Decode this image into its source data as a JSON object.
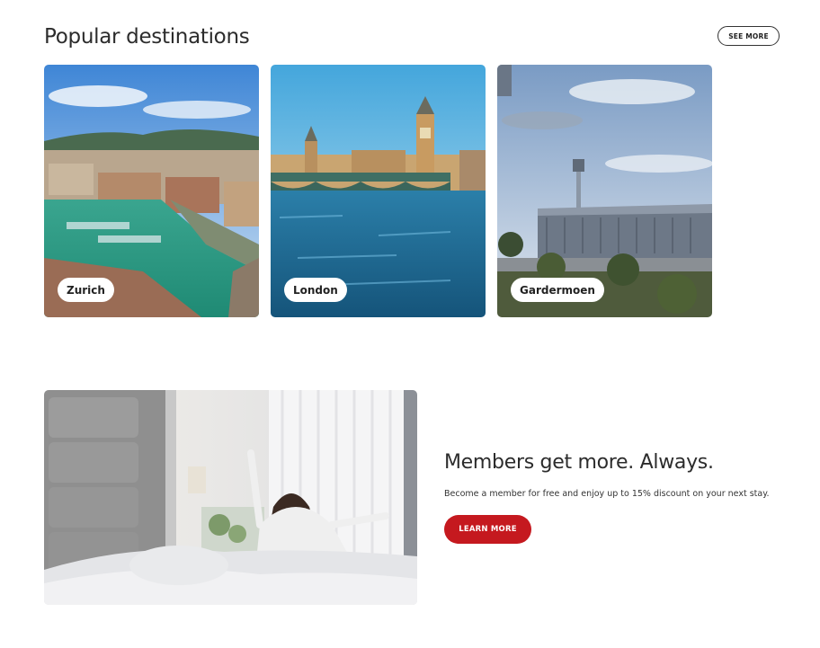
{
  "destinations": {
    "title": "Popular destinations",
    "see_more_label": "SEE MORE",
    "items": [
      {
        "label": "Zurich"
      },
      {
        "label": "London"
      },
      {
        "label": "Gardermoen"
      }
    ]
  },
  "promo": {
    "heading": "Members get more. Always.",
    "text": "Become a member for free and enjoy up to 15% discount on your next stay.",
    "button_label": "LEARN MORE"
  },
  "colors": {
    "accent": "#c5191f",
    "text": "#2c2c2c",
    "background": "#ffffff"
  }
}
